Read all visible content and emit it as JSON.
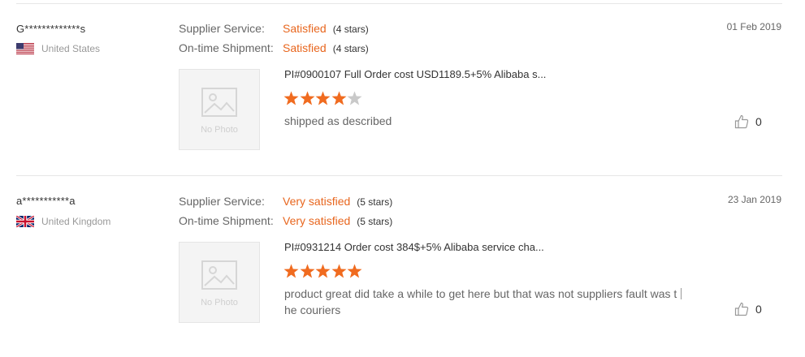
{
  "reviews": [
    {
      "buyer": "G*************s",
      "country": "United States",
      "flag_icon": "us-flag-icon",
      "date": "01 Feb 2019",
      "supplier_service": {
        "label": "Supplier Service:",
        "value": "Satisfied",
        "stars_text": "(4 stars)"
      },
      "ontime_shipment": {
        "label": "On-time Shipment:",
        "value": "Satisfied",
        "stars_text": "(4 stars)"
      },
      "photo_placeholder": "No Photo",
      "product_title": "PI#0900107 Full Order cost USD1189.5+5% Alibaba s...",
      "rating": 4,
      "comment": "shipped as described",
      "helpful_count": "0"
    },
    {
      "buyer": "a***********a",
      "country": "United Kingdom",
      "flag_icon": "uk-flag-icon",
      "date": "23 Jan 2019",
      "supplier_service": {
        "label": "Supplier Service:",
        "value": "Very satisfied",
        "stars_text": "(5 stars)"
      },
      "ontime_shipment": {
        "label": "On-time Shipment:",
        "value": "Very satisfied",
        "stars_text": "(5 stars)"
      },
      "photo_placeholder": "No Photo",
      "product_title": "PI#0931214 Order cost 384$+5% Alibaba service cha...",
      "rating": 5,
      "comment_line1": "product great did take a while to get here but that was not suppliers fault was t",
      "comment_line2": "he couriers",
      "helpful_count": "0"
    }
  ],
  "colors": {
    "accent": "#e8661e",
    "star_filled": "#f06b1f",
    "star_empty": "#c9c9c9"
  }
}
